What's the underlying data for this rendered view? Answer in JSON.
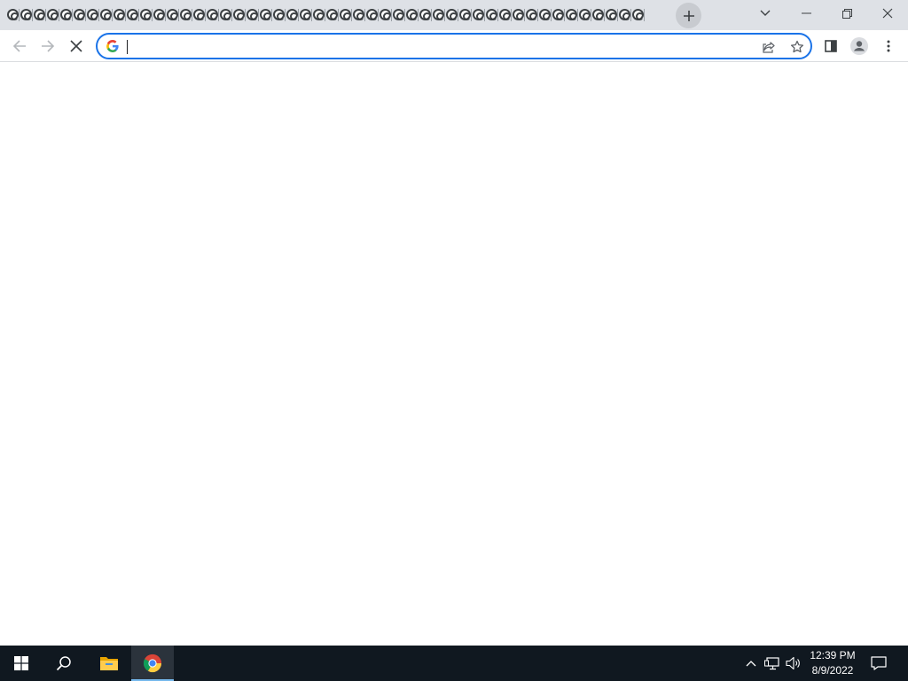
{
  "browser": {
    "tab_count": 48,
    "tab_icon": "chrome-sad-face-icon",
    "window_controls": {
      "tab_search": "chevron-down-icon",
      "minimize": "minimize-icon",
      "restore": "restore-icon",
      "close": "close-icon"
    },
    "new_tab_icon": "plus-icon"
  },
  "toolbar": {
    "back_icon": "back-arrow-icon",
    "forward_icon": "forward-arrow-icon",
    "stop_icon": "stop-loading-icon",
    "omnibox": {
      "value": "",
      "search_engine_icon": "google-icon",
      "share_icon": "share-icon",
      "bookmark_icon": "star-icon"
    },
    "side_panel_icon": "side-panel-icon",
    "profile_icon": "profile-icon",
    "menu_icon": "kebab-menu-icon"
  },
  "taskbar": {
    "start_icon": "windows-start-icon",
    "search_icon": "search-icon",
    "pinned": [
      {
        "name": "file-explorer",
        "icon": "folder-icon",
        "active": false
      },
      {
        "name": "chrome",
        "icon": "chrome-icon",
        "active": true
      }
    ],
    "tray": {
      "overflow_icon": "chevron-up-icon",
      "network_icon": "network-icon",
      "volume_icon": "speaker-icon",
      "notification_icon": "notification-icon"
    },
    "clock": {
      "time": "12:39 PM",
      "date": "8/9/2022"
    }
  },
  "colors": {
    "titlebar": "#dee1e6",
    "focus_ring": "#1a73e8",
    "taskbar": "#101820",
    "taskbar_active_indicator": "#76b9ed"
  }
}
